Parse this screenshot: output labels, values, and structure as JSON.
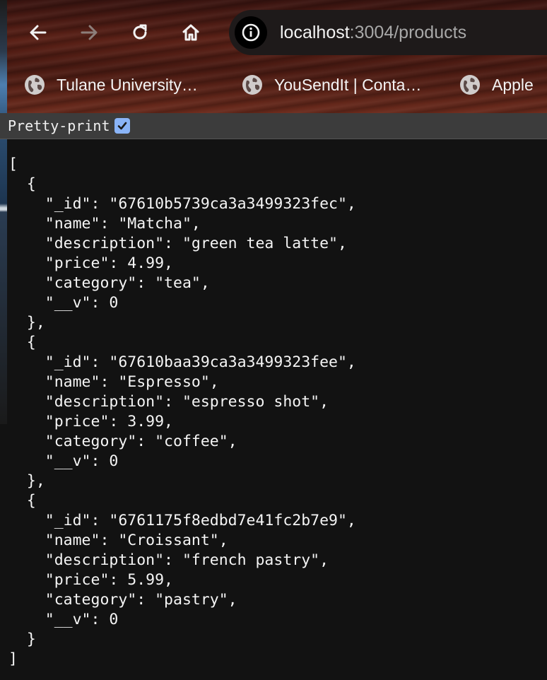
{
  "browser": {
    "url_host": "localhost",
    "url_path": ":3004/products",
    "bookmarks": [
      {
        "label": "Tulane University…",
        "icon": "globe-icon"
      },
      {
        "label": "YouSendIt | Conta…",
        "icon": "globe-icon"
      },
      {
        "label": "Apple",
        "icon": "globe-icon"
      }
    ]
  },
  "viewer": {
    "pretty_print_label": "Pretty-print",
    "pretty_print_checked": true
  },
  "json_lines": [
    "[",
    "  {",
    "    \"_id\": \"67610b5739ca3a3499323fec\",",
    "    \"name\": \"Matcha\",",
    "    \"description\": \"green tea latte\",",
    "    \"price\": 4.99,",
    "    \"category\": \"tea\",",
    "    \"__v\": 0",
    "  },",
    "  {",
    "    \"_id\": \"67610baa39ca3a3499323fee\",",
    "    \"name\": \"Espresso\",",
    "    \"description\": \"espresso shot\",",
    "    \"price\": 3.99,",
    "    \"category\": \"coffee\",",
    "    \"__v\": 0",
    "  },",
    "  {",
    "    \"_id\": \"6761175f8edbd7e41fc2b7e9\",",
    "    \"name\": \"Croissant\",",
    "    \"description\": \"french pastry\",",
    "    \"price\": 5.99,",
    "    \"category\": \"pastry\",",
    "    \"__v\": 0",
    "  }",
    "]"
  ],
  "colors": {
    "content_bg": "#121212",
    "checkbox": "#8ab4f8",
    "toolbar_bg": "#3c3c3c"
  }
}
